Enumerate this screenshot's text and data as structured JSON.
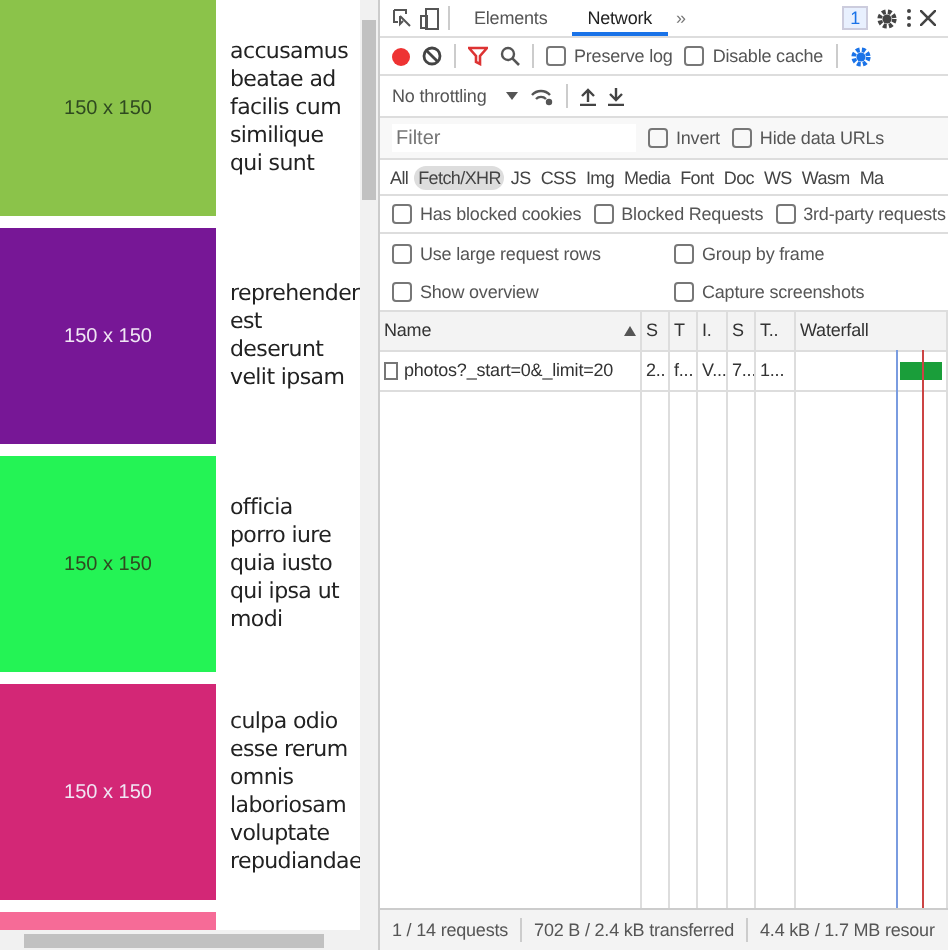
{
  "page": {
    "items": [
      {
        "color": "#8bc34a",
        "placeholder": "150 x 150",
        "caption": "accusamus beatae ad facilis cum similique qui sunt"
      },
      {
        "color": "#771796",
        "placeholder": "150 x 150",
        "caption": "reprehender est deserunt velit ipsam"
      },
      {
        "color": "#24f355",
        "placeholder": "150 x 150",
        "caption": "officia porro iure quia iusto qui ipsa ut modi"
      },
      {
        "color": "#d32776",
        "placeholder": "150 x 150",
        "caption": "culpa odio esse rerum omnis laboriosam voluptate repudiandae"
      },
      {
        "color": "#f66b97"
      }
    ]
  },
  "devtools": {
    "tabs": [
      {
        "label": "Elements",
        "selected": false
      },
      {
        "label": "Network",
        "selected": true
      }
    ],
    "more_tabs": "»",
    "issues_badge": "1",
    "recording": true,
    "preserve_log": {
      "label": "Preserve log",
      "checked": false
    },
    "disable_cache": {
      "label": "Disable cache",
      "checked": false
    },
    "throttling": "No throttling",
    "filter": {
      "placeholder": "Filter"
    },
    "invert": {
      "label": "Invert",
      "checked": false
    },
    "hide_data_urls": {
      "label": "Hide data URLs",
      "checked": false
    },
    "type_filters": [
      {
        "label": "All",
        "selected": false
      },
      {
        "label": "Fetch/XHR",
        "selected": true
      },
      {
        "label": "JS",
        "selected": false
      },
      {
        "label": "CSS",
        "selected": false
      },
      {
        "label": "Img",
        "selected": false
      },
      {
        "label": "Media",
        "selected": false
      },
      {
        "label": "Font",
        "selected": false
      },
      {
        "label": "Doc",
        "selected": false
      },
      {
        "label": "WS",
        "selected": false
      },
      {
        "label": "Wasm",
        "selected": false
      },
      {
        "label": "Ma",
        "selected": false
      }
    ],
    "blocked_filters": [
      {
        "label": "Has blocked cookies",
        "checked": false
      },
      {
        "label": "Blocked Requests",
        "checked": false
      },
      {
        "label": "3rd-party requests",
        "checked": false
      }
    ],
    "settings": [
      {
        "label": "Use large request rows",
        "checked": false
      },
      {
        "label": "Group by frame",
        "checked": false
      },
      {
        "label": "Show overview",
        "checked": false
      },
      {
        "label": "Capture screenshots",
        "checked": false
      }
    ],
    "table": {
      "columns": [
        "Name",
        "S",
        "T",
        "I.",
        "S",
        "T..",
        "Waterfall"
      ],
      "rows": [
        {
          "selected": false,
          "cells": [
            "photos?_start=0&_limit=20",
            "2..",
            "f...",
            "V...",
            "7...",
            "1..."
          ]
        }
      ]
    },
    "status_bar": [
      "1 / 14 requests",
      "702 B / 2.4 kB transferred",
      "4.4 kB / 1.7 MB resour"
    ]
  }
}
